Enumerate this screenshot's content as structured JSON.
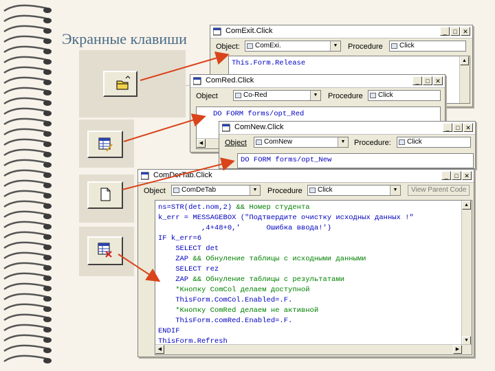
{
  "slide": {
    "title": "Экранные клавиши"
  },
  "windows": {
    "exit": {
      "title": "ComExit.Click",
      "object_label": "Object:",
      "object_value": "ComExi.",
      "procedure_label": "Procedure",
      "procedure_value": "Click",
      "code": [
        "This.Form.Release"
      ]
    },
    "red": {
      "title": "ComRed.Click",
      "object_label": "Object",
      "object_value": "Co-Red",
      "procedure_label": "Procedure",
      "procedure_value": "Click",
      "code": [
        "DO FORM forms/opt_Red"
      ]
    },
    "new": {
      "title": "ComNew.Click",
      "object_label": "Object",
      "object_value": "ComNew",
      "procedure_label": "Procedure:",
      "procedure_value": "Click",
      "code": [
        "DO FORM forms/opt_New"
      ]
    },
    "tab": {
      "title": "ComDerTab.Click",
      "object_label": "Object",
      "object_value": "ComDeTab",
      "procedure_label": "Procedure",
      "procedure_value": "Click",
      "view_parent": "View Parent Code",
      "lines": [
        {
          "a": "ns=STR(det.nom,2)",
          "b": "&& Номер студента"
        },
        {
          "a": "k_err = MESSAGEBOX (\"Подтвердите очистку исходных данных !\"",
          "b": ""
        },
        {
          "a": "          ,4+48+0,'      Ошибка ввода!')",
          "b": ""
        },
        {
          "a": "IF k_err=6",
          "b": ""
        },
        {
          "a": "    SELECT det",
          "b": ""
        },
        {
          "a": "    ZAP",
          "b": "&& Обнуление таблицы с исходными данными"
        },
        {
          "a": "    SELECT rez",
          "b": ""
        },
        {
          "a": "    ZAP",
          "b": "&& Обнуление таблицы с результатами"
        },
        {
          "a": "",
          "b": "    *Кнопку ComCol делаем доступной"
        },
        {
          "a": "    ThisForm.ComCol.Enabled=.F.",
          "b": ""
        },
        {
          "a": "",
          "b": "    *Кнопку ComRed делаем не активной"
        },
        {
          "a": "    ThisForm.comRed.Enabled=.F.",
          "b": ""
        },
        {
          "a": "ENDIF",
          "b": ""
        },
        {
          "a": "ThisForm.Refresh",
          "b": ""
        }
      ]
    }
  },
  "colors": {
    "arrow": "#d9441b",
    "title": "#4a6a85",
    "keyword": "#0000c0",
    "comment": "#008000"
  },
  "icons": [
    "folder-open-icon",
    "edit-table-icon",
    "new-document-icon",
    "clear-table-icon",
    "spiral-binding-icon"
  ]
}
